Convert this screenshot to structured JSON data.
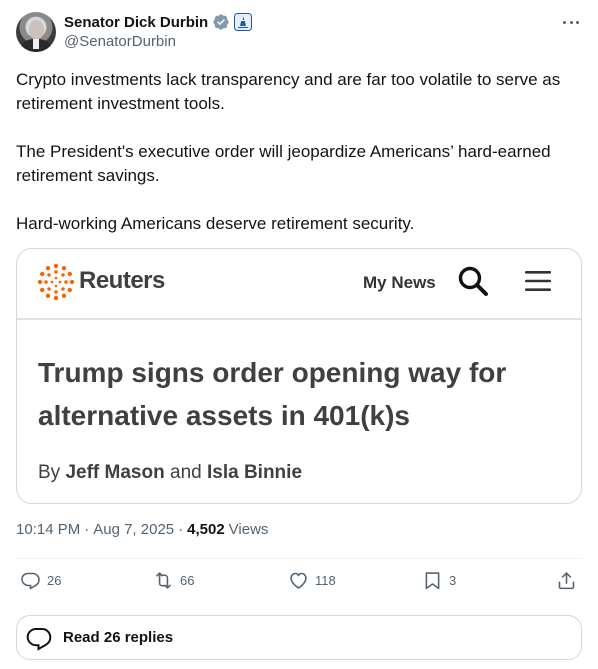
{
  "author": {
    "display_name": "Senator Dick Durbin",
    "handle": "@SenatorDurbin",
    "verified_badge_color": "#829aab",
    "gov_badge_color": "#1d5aad"
  },
  "tweet": {
    "paragraphs": [
      "Crypto investments lack transparency and are far too volatile to serve as retirement investment tools.",
      "The President's executive order will jeopardize Americans’ hard-earned retirement savings.",
      "Hard-working Americans deserve retirement security."
    ]
  },
  "card": {
    "brand": "Reuters",
    "brand_color": "#fa6400",
    "nav_label": "My News",
    "headline": "Trump signs order opening way for alternative assets in 401(k)s",
    "byline_prefix": "By",
    "author_1": "Jeff Mason",
    "byline_joiner": "and",
    "author_2": "Isla Binnie"
  },
  "meta": {
    "time": "10:14 PM",
    "separator": "·",
    "date": "Aug 7, 2025",
    "views_count": "4,502",
    "views_label": "Views"
  },
  "actions": {
    "replies": "26",
    "reposts": "66",
    "likes": "118",
    "bookmarks": "3"
  },
  "read_replies_label": "Read 26 replies"
}
